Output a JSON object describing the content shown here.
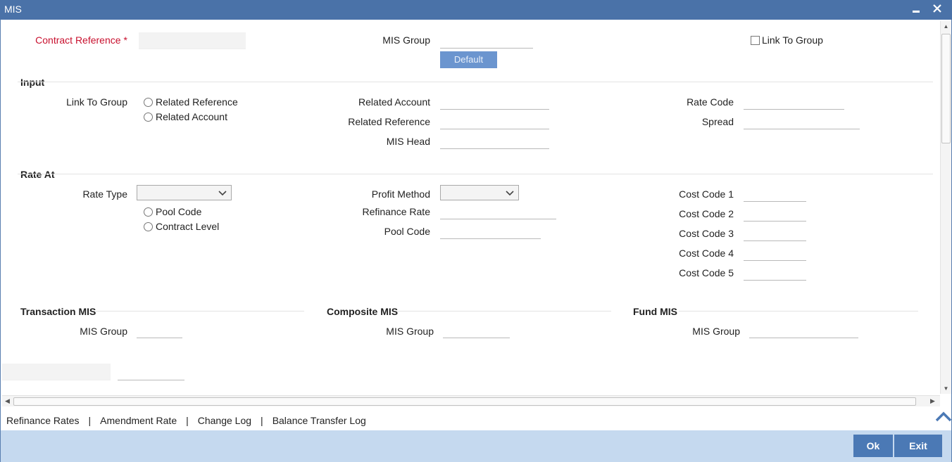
{
  "window": {
    "title": "MIS",
    "minimize_icon": "minimize-icon",
    "close_icon": "close-icon"
  },
  "header": {
    "contract_reference_label": "Contract Reference",
    "contract_reference_value": "",
    "required_marker": "*",
    "mis_group_label": "MIS Group",
    "mis_group_value": "",
    "default_button": "Default",
    "link_to_group_checkbox": "Link To Group"
  },
  "input_section": {
    "title": "Input",
    "link_to_group_label": "Link To Group",
    "radio_related_reference": "Related Reference",
    "radio_related_account": "Related Account",
    "related_account_label": "Related Account",
    "related_reference_label": "Related Reference",
    "mis_head_label": "MIS Head",
    "rate_code_label": "Rate Code",
    "spread_label": "Spread"
  },
  "rate_at_section": {
    "title": "Rate At",
    "rate_type_label": "Rate Type",
    "radio_pool_code": "Pool Code",
    "radio_contract_level": "Contract Level",
    "profit_method_label": "Profit Method",
    "refinance_rate_label": "Refinance Rate",
    "pool_code_label": "Pool Code",
    "cost_codes": [
      "Cost Code 1",
      "Cost Code 2",
      "Cost Code 3",
      "Cost Code 4",
      "Cost Code 5"
    ]
  },
  "transaction_mis": {
    "title": "Transaction MIS",
    "mis_group_label": "MIS Group"
  },
  "composite_mis": {
    "title": "Composite MIS",
    "mis_group_label": "MIS Group"
  },
  "fund_mis": {
    "title": "Fund MIS",
    "mis_group_label": "MIS Group"
  },
  "links": {
    "refinance_rates": "Refinance Rates",
    "amendment_rate": "Amendment Rate",
    "change_log": "Change Log",
    "balance_transfer_log": "Balance Transfer Log",
    "separator": "|"
  },
  "footer": {
    "ok_button": "Ok",
    "exit_button": "Exit"
  },
  "colors": {
    "titlebar": "#4a72a8",
    "required": "#c8102e",
    "footer": "#c5d9ef",
    "button": "#4b79b5"
  }
}
